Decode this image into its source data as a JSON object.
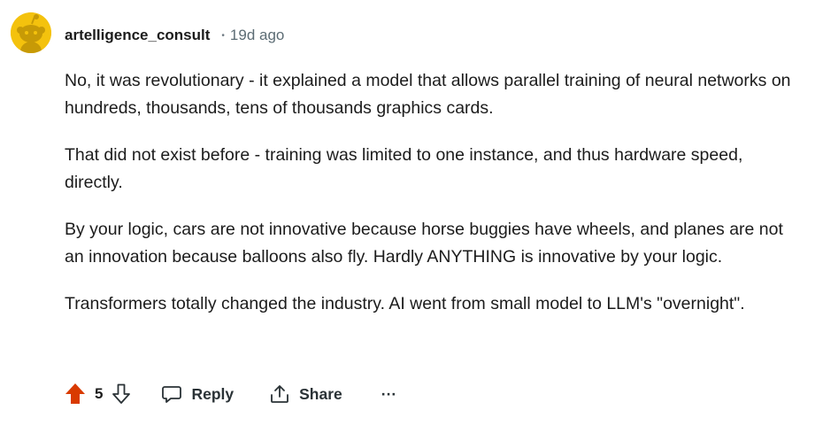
{
  "comment": {
    "author": "artelligence_consult",
    "separator": "•",
    "time": "19d ago",
    "paragraphs": [
      "No, it was revolutionary - it explained a model that allows parallel training of neural networks on hundreds, thousands, tens of thousands graphics cards.",
      "That did not exist before - training was limited to one instance, and thus hardware speed, directly.",
      "By your logic, cars are not innovative because horse buggies have wheels, and planes are not an innovation because balloons also fly. Hardly ANYTHING is innovative by your logic.",
      "Transformers totally changed the industry. AI went from small model to LLM's \"overnight\"."
    ]
  },
  "actions": {
    "score": "5",
    "reply_label": "Reply",
    "share_label": "Share",
    "more_label": "···"
  },
  "icons": {
    "avatar": "reddit-snoo-avatar-icon",
    "upvote": "upvote-arrow-icon",
    "downvote": "downvote-arrow-icon",
    "reply": "speech-bubble-icon",
    "share": "share-icon",
    "more": "overflow-dots-icon"
  },
  "colors": {
    "avatar_bg": "#f4c20d",
    "upvote_active": "#d93a00",
    "text": "#1c1c1c",
    "meta": "#5c6c74"
  }
}
